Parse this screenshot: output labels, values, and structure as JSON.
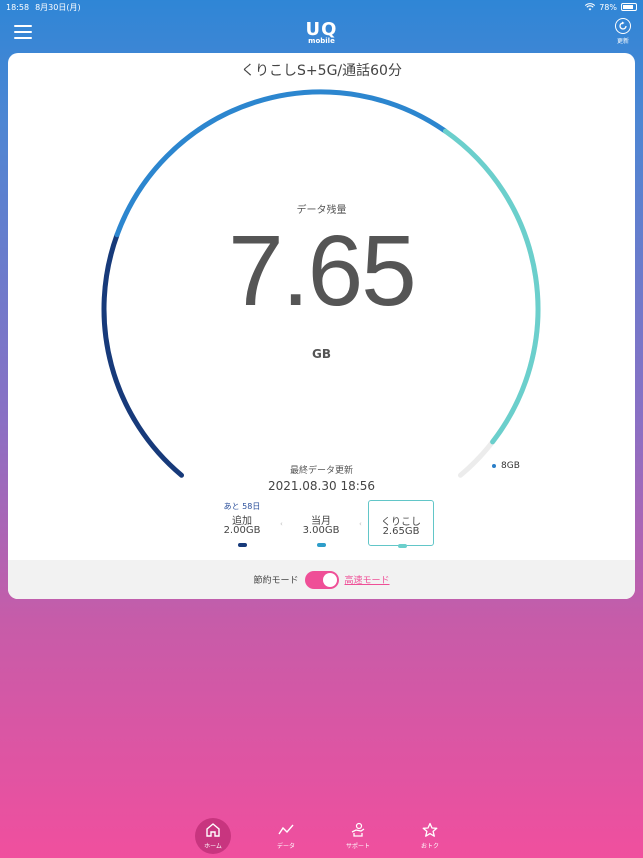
{
  "status": {
    "time": "18:58",
    "date": "8月30日(月)",
    "battery": "78%"
  },
  "header": {
    "logo_main": "UQ",
    "logo_sub": "mobile",
    "refresh_label": "更新"
  },
  "plan": {
    "title": "くりこしS+5G/通話60分"
  },
  "gauge": {
    "label": "データ残量",
    "value": "7.65",
    "unit": "GB",
    "max_label": "8GB",
    "max_gb": 8,
    "remaining_gb": 7.65,
    "segments": [
      {
        "name": "追加",
        "gb": 2.0,
        "color": "#173a7a"
      },
      {
        "name": "当月",
        "gb": 3.0,
        "color": "#2c86cf"
      },
      {
        "name": "くりこし",
        "gb": 2.65,
        "color": "#6bcfcc"
      }
    ],
    "track_color": "#ececec"
  },
  "update": {
    "label": "最終データ更新",
    "time": "2021.08.30 18:56"
  },
  "buckets": [
    {
      "remain": "あと 58日",
      "name": "追加",
      "value": "2.00GB",
      "color": "#173a7a"
    },
    {
      "remain": "",
      "name": "当月",
      "value": "3.00GB",
      "color": "#2e9dc9"
    },
    {
      "remain": "",
      "name": "くりこし",
      "value": "2.65GB",
      "color": "#6bcfcc"
    }
  ],
  "mode": {
    "save_label": "節約モード",
    "fast_label": "高速モード"
  },
  "tabs": [
    {
      "label": "ホーム",
      "icon": "home-icon"
    },
    {
      "label": "データ",
      "icon": "chart-icon"
    },
    {
      "label": "サポート",
      "icon": "support-icon"
    },
    {
      "label": "おトク",
      "icon": "star-icon"
    }
  ]
}
